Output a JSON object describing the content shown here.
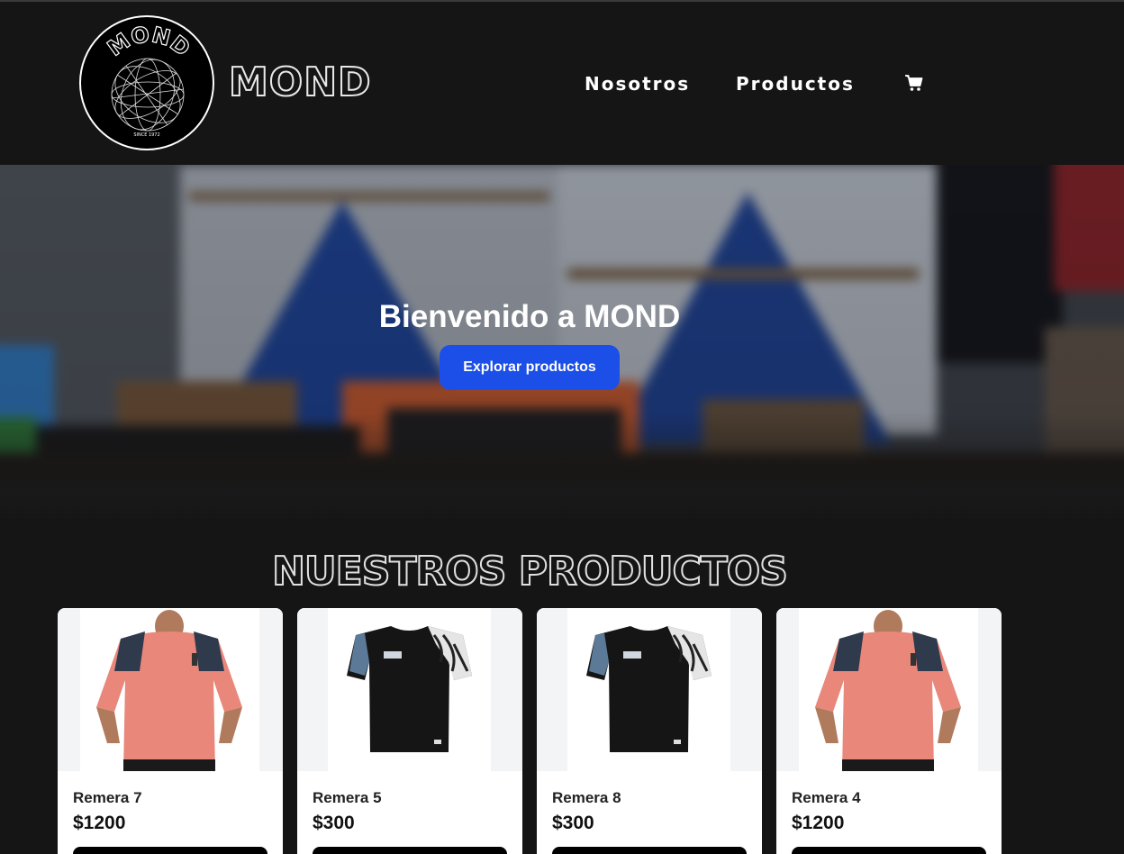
{
  "brand": {
    "name": "MOND",
    "logo_text": "MOND",
    "logo_subtext": "SINCE 1972"
  },
  "nav": {
    "items": [
      {
        "label": "Nosotros"
      },
      {
        "label": "Productos"
      }
    ],
    "cart_icon": "cart-icon"
  },
  "hero": {
    "title": "Bienvenido a MOND",
    "button_label": "Explorar productos"
  },
  "products_section": {
    "title": "NUESTROS PRODUCTOS",
    "products": [
      {
        "name": "Remera 7",
        "price": "$1200",
        "image": "pink-raglan-tshirt"
      },
      {
        "name": "Remera 5",
        "price": "$300",
        "image": "black-sport-tshirt"
      },
      {
        "name": "Remera 8",
        "price": "$300",
        "image": "black-sport-tshirt"
      },
      {
        "name": "Remera 4",
        "price": "$1200",
        "image": "pink-raglan-tshirt"
      }
    ]
  },
  "colors": {
    "background": "#151515",
    "accent_button": "#1c4fe8",
    "card_background": "#ffffff"
  }
}
